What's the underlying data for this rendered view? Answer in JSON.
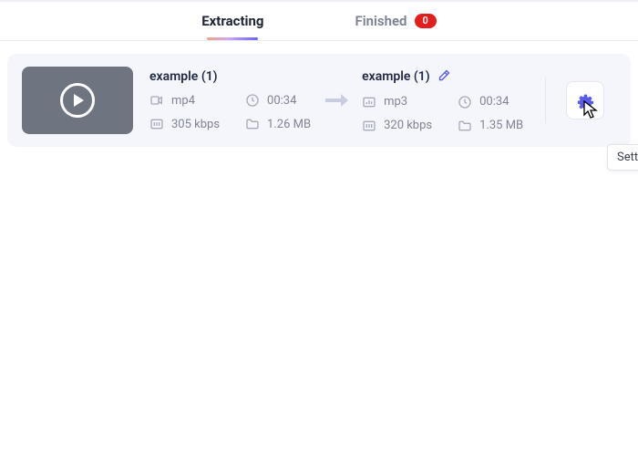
{
  "tabs": {
    "extracting": "Extracting",
    "finished": "Finished",
    "finished_count": "0"
  },
  "source": {
    "name": "example (1)",
    "format": "mp4",
    "duration": "00:34",
    "bitrate": "305 kbps",
    "size": "1.26 MB"
  },
  "target": {
    "name": "example (1)",
    "format": "mp3",
    "duration": "00:34",
    "bitrate": "320 kbps",
    "size": "1.35 MB"
  },
  "tooltip": "Settings"
}
